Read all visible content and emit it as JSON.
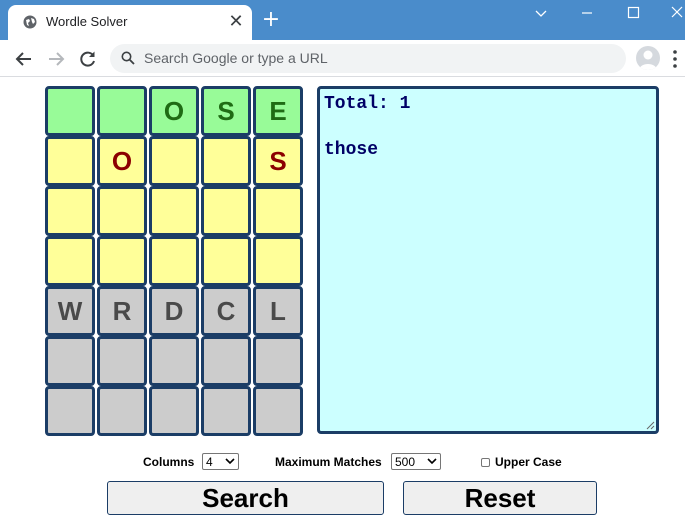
{
  "browser": {
    "tab_title": "Wordle Solver",
    "tab_close": "✕",
    "new_tab": "+",
    "omnibox_placeholder": "Search Google or type a URL"
  },
  "grid": {
    "rows": [
      [
        {
          "letter": "",
          "state": "green"
        },
        {
          "letter": "",
          "state": "green"
        },
        {
          "letter": "O",
          "state": "green"
        },
        {
          "letter": "S",
          "state": "green"
        },
        {
          "letter": "E",
          "state": "green"
        }
      ],
      [
        {
          "letter": "",
          "state": "yellow"
        },
        {
          "letter": "O",
          "state": "yellow"
        },
        {
          "letter": "",
          "state": "yellow"
        },
        {
          "letter": "",
          "state": "yellow"
        },
        {
          "letter": "S",
          "state": "yellow"
        }
      ],
      [
        {
          "letter": "",
          "state": "yellow"
        },
        {
          "letter": "",
          "state": "yellow"
        },
        {
          "letter": "",
          "state": "yellow"
        },
        {
          "letter": "",
          "state": "yellow"
        },
        {
          "letter": "",
          "state": "yellow"
        }
      ],
      [
        {
          "letter": "",
          "state": "yellow"
        },
        {
          "letter": "",
          "state": "yellow"
        },
        {
          "letter": "",
          "state": "yellow"
        },
        {
          "letter": "",
          "state": "yellow"
        },
        {
          "letter": "",
          "state": "yellow"
        }
      ],
      [
        {
          "letter": "W",
          "state": "gray"
        },
        {
          "letter": "R",
          "state": "gray"
        },
        {
          "letter": "D",
          "state": "gray"
        },
        {
          "letter": "C",
          "state": "gray"
        },
        {
          "letter": "L",
          "state": "gray"
        }
      ],
      [
        {
          "letter": "",
          "state": "gray"
        },
        {
          "letter": "",
          "state": "gray"
        },
        {
          "letter": "",
          "state": "gray"
        },
        {
          "letter": "",
          "state": "gray"
        },
        {
          "letter": "",
          "state": "gray"
        }
      ],
      [
        {
          "letter": "",
          "state": "gray"
        },
        {
          "letter": "",
          "state": "gray"
        },
        {
          "letter": "",
          "state": "gray"
        },
        {
          "letter": "",
          "state": "gray"
        },
        {
          "letter": "",
          "state": "gray"
        }
      ]
    ]
  },
  "output": {
    "total_line": "Total: 1",
    "results": [
      "those"
    ]
  },
  "options": {
    "columns_label": "Columns",
    "columns_value": "4",
    "max_matches_label": "Maximum Matches",
    "max_matches_value": "500",
    "upper_case_label": "Upper Case",
    "upper_case_checked": false
  },
  "buttons": {
    "search_label": "Search",
    "reset_label": "Reset"
  },
  "colors": {
    "titlebar": "#4a8ccb",
    "green_cell": "#98fb98",
    "yellow_cell": "#ffff99",
    "gray_cell": "#cccccc",
    "cell_border": "#1b3d66",
    "output_bg": "#ccffff"
  }
}
